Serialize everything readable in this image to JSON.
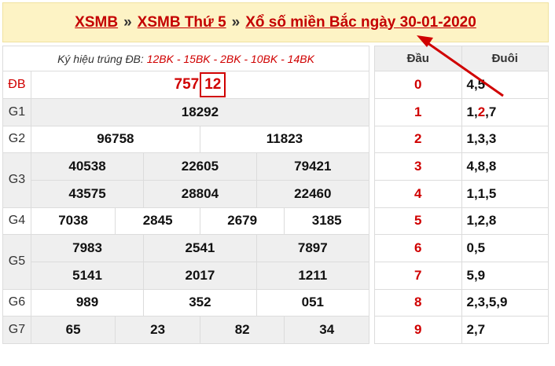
{
  "header": {
    "link1": "XSMB",
    "sep1": "»",
    "link2": "XSMB Thứ 5",
    "sep2": "»",
    "link3": "Xổ số miền Bắc ngày 30-01-2020"
  },
  "symbols": {
    "label": "Ký hiệu trúng ĐB:",
    "codes": "12BK - 15BK - 2BK - 10BK - 14BK"
  },
  "prizes": {
    "db": {
      "label": "ĐB",
      "head": "757",
      "tail": "12"
    },
    "g1": {
      "label": "G1",
      "values": [
        "18292"
      ]
    },
    "g2": {
      "label": "G2",
      "values": [
        "96758",
        "11823"
      ]
    },
    "g3": {
      "label": "G3",
      "values": [
        "40538",
        "22605",
        "79421",
        "43575",
        "28804",
        "22460"
      ]
    },
    "g4": {
      "label": "G4",
      "values": [
        "7038",
        "2845",
        "2679",
        "3185"
      ]
    },
    "g5": {
      "label": "G5",
      "values": [
        "7983",
        "2541",
        "7897",
        "5141",
        "2017",
        "1211"
      ]
    },
    "g6": {
      "label": "G6",
      "values": [
        "989",
        "352",
        "051"
      ]
    },
    "g7": {
      "label": "G7",
      "values": [
        "65",
        "23",
        "82",
        "34"
      ]
    }
  },
  "loto": {
    "head_label": "Đầu",
    "tail_label": "Đuôi",
    "rows": [
      {
        "dau": "0",
        "duoi": "4,5"
      },
      {
        "dau": "1",
        "duoi_a": "1,",
        "duoi_hl": "2",
        "duoi_b": ",7"
      },
      {
        "dau": "2",
        "duoi": "1,3,3"
      },
      {
        "dau": "3",
        "duoi": "4,8,8"
      },
      {
        "dau": "4",
        "duoi": "1,1,5"
      },
      {
        "dau": "5",
        "duoi": "1,2,8"
      },
      {
        "dau": "6",
        "duoi": "0,5"
      },
      {
        "dau": "7",
        "duoi": "5,9"
      },
      {
        "dau": "8",
        "duoi": "2,3,5,9"
      },
      {
        "dau": "9",
        "duoi": "2,7"
      }
    ]
  },
  "colors": {
    "accent": "#d00000",
    "header_bg": "#fdf3c5",
    "row_shade": "#efefef"
  }
}
